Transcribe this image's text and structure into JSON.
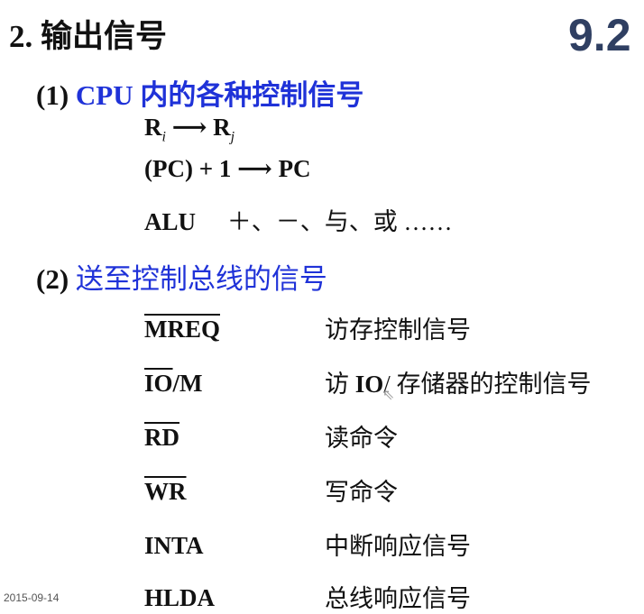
{
  "heading": "2. 输出信号",
  "section_number": "9.2",
  "part1": {
    "num": "(1)",
    "title": "CPU 内的各种控制信号",
    "transfer": {
      "src": "R",
      "src_sub": "i",
      "arrow": "⟶",
      "dst": "R",
      "dst_sub": "j"
    },
    "pc_line": "(PC) + 1 ⟶ PC",
    "alu_label": "ALU",
    "alu_ops": "＋、－、与、或 ……"
  },
  "part2": {
    "num": "(2)",
    "title": "送至控制总线的信号",
    "signals": [
      {
        "name": "MREQ",
        "overline": "MREQ",
        "rest": "",
        "desc": "访存控制信号"
      },
      {
        "name": "IO/M",
        "overline": "IO",
        "rest": "/M",
        "desc_prefix": "访 ",
        "desc_bold": "IO",
        "desc_suffix": "/ 存储器的控制信号"
      },
      {
        "name": "RD",
        "overline": "RD",
        "rest": "",
        "desc": "读命令"
      },
      {
        "name": "WR",
        "overline": "WR",
        "rest": "",
        "desc": "写命令"
      },
      {
        "name": "INTA",
        "overline": "",
        "rest": "INTA",
        "desc": "中断响应信号"
      },
      {
        "name": "HLDA",
        "overline": "",
        "rest": "HLDA",
        "desc": "总线响应信号"
      }
    ]
  },
  "footer_date": "2015-09-14",
  "colors": {
    "title_blue": "#1f32d8",
    "section_number": "#2f3f62"
  },
  "icons": {
    "cursor": "mouse-cursor-icon"
  }
}
